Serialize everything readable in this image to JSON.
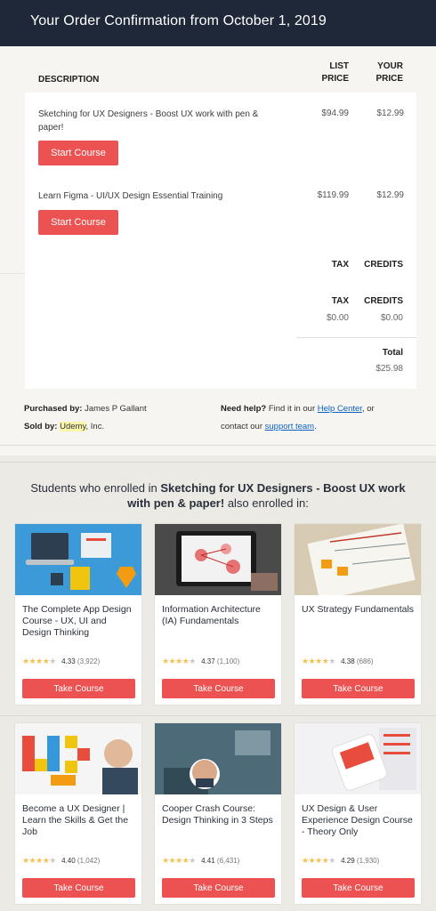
{
  "header": {
    "title": "Your Order Confirmation from October 1, 2019"
  },
  "table": {
    "col_description": "DESCRIPTION",
    "col_list_price": [
      "LIST",
      "PRICE"
    ],
    "col_your_price": [
      "YOUR",
      "PRICE"
    ],
    "items": [
      {
        "title": "Sketching for UX Designers - Boost UX work with pen & paper!",
        "list_price": "$94.99",
        "your_price": "$12.99",
        "button": "Start Course"
      },
      {
        "title": "Learn Figma - UI/UX Design Essential Training",
        "list_price": "$119.99",
        "your_price": "$12.99",
        "button": "Start Course"
      }
    ],
    "tax_label_1": "TAX",
    "credits_label_1": "CREDITS",
    "tax_label_2": "TAX",
    "credits_label_2": "CREDITS",
    "tax_value": "$0.00",
    "credits_value": "$0.00",
    "total_label": "Total",
    "total_value": "$25.98"
  },
  "footer": {
    "purchased_by_label": "Purchased by:",
    "purchased_by_value": "James P Gallant",
    "sold_by_label": "Sold by:",
    "sold_by_brand": "Udemy",
    "sold_by_suffix": ", Inc.",
    "help_label": "Need help?",
    "help_text_1": "Find it in our",
    "help_link": "Help Center",
    "help_text_2": ", or",
    "help_text_3": "contact our",
    "support_link": "support team",
    "help_text_4": "."
  },
  "recommendations": {
    "intro_1": "Students who enrolled in",
    "intro_course": "Sketching for UX Designers - Boost UX work with pen & paper!",
    "intro_2": "also enrolled in:",
    "courses": [
      {
        "title": "The Complete App Design Course - UX, UI and Design Thinking",
        "rating": "4.33",
        "count": "(3,922)",
        "button": "Take Course"
      },
      {
        "title": "Information Architecture (IA) Fundamentals",
        "rating": "4.37",
        "count": "(1,100)",
        "button": "Take Course"
      },
      {
        "title": "UX Strategy Fundamentals",
        "rating": "4.38",
        "count": "(686)",
        "button": "Take Course"
      },
      {
        "title": "Become a UX Designer | Learn the Skills & Get the Job",
        "rating": "4.40",
        "count": "(1,042)",
        "button": "Take Course"
      },
      {
        "title": "Cooper Crash Course: Design Thinking in 3 Steps",
        "rating": "4.41",
        "count": "(6,431)",
        "button": "Take Course"
      },
      {
        "title": "UX Design & User Experience Design Course - Theory Only",
        "rating": "4.29",
        "count": "(1,930)",
        "button": "Take Course"
      }
    ]
  },
  "colors": {
    "header_bg": "#1f2838",
    "accent": "#ec5252",
    "star": "#f4c150",
    "link": "#0b62c4"
  }
}
